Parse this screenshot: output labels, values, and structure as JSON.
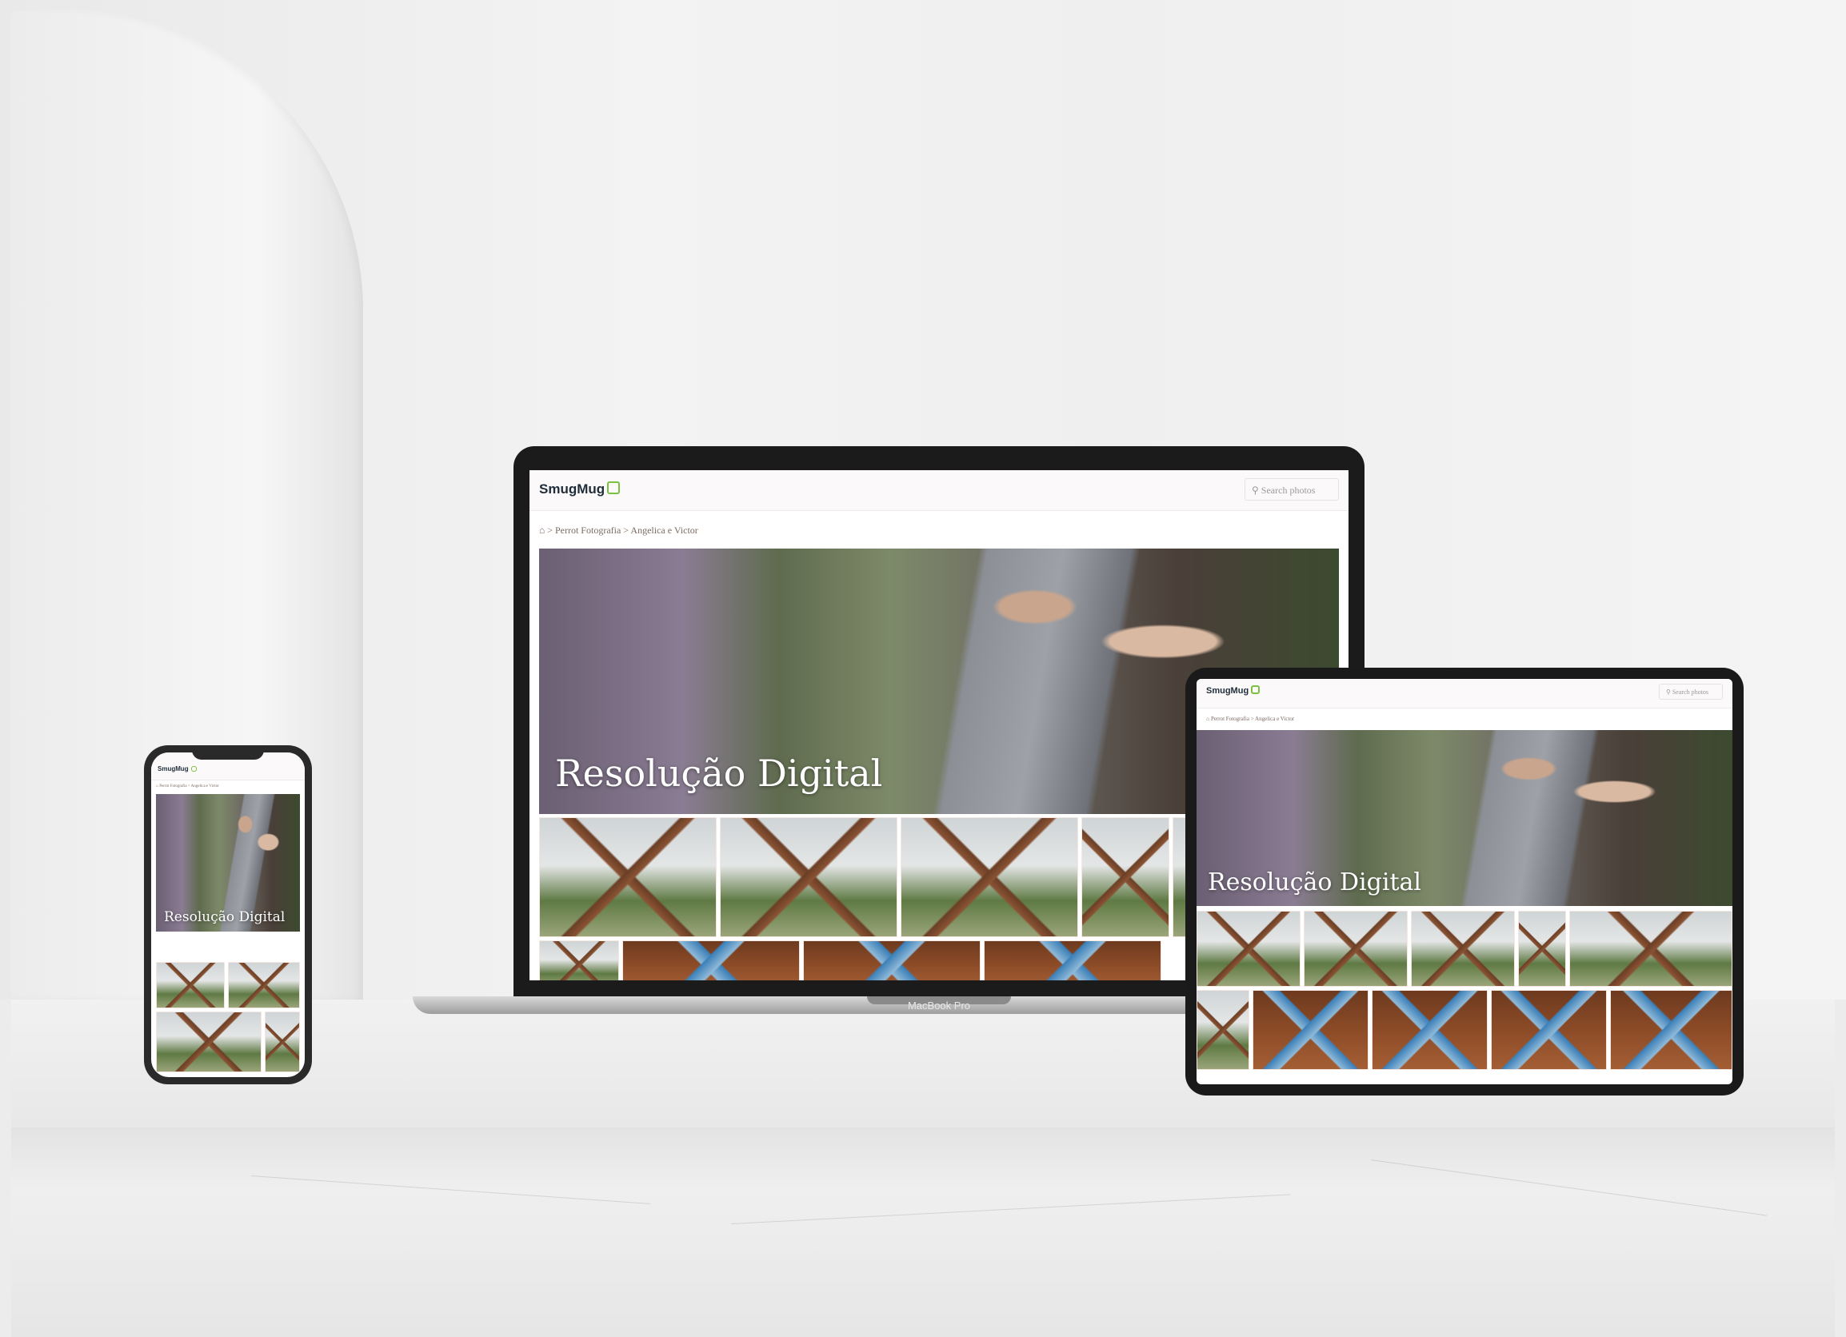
{
  "site": {
    "logo": "SmugMug",
    "search_placeholder": "Search photos",
    "breadcrumb": [
      "Perrot Fotografia",
      "Angelica e Victor"
    ],
    "breadcrumb_sep": ">",
    "gallery_title": "Resolução Digital"
  },
  "devices": {
    "laptop_label": "MacBook Pro"
  },
  "icons": {
    "home": "home-icon",
    "search": "search-icon",
    "logo_mark": "smugmug-logo-icon"
  },
  "colors": {
    "brand_green": "#7ac142",
    "breadcrumb_text": "#7b6b62"
  }
}
